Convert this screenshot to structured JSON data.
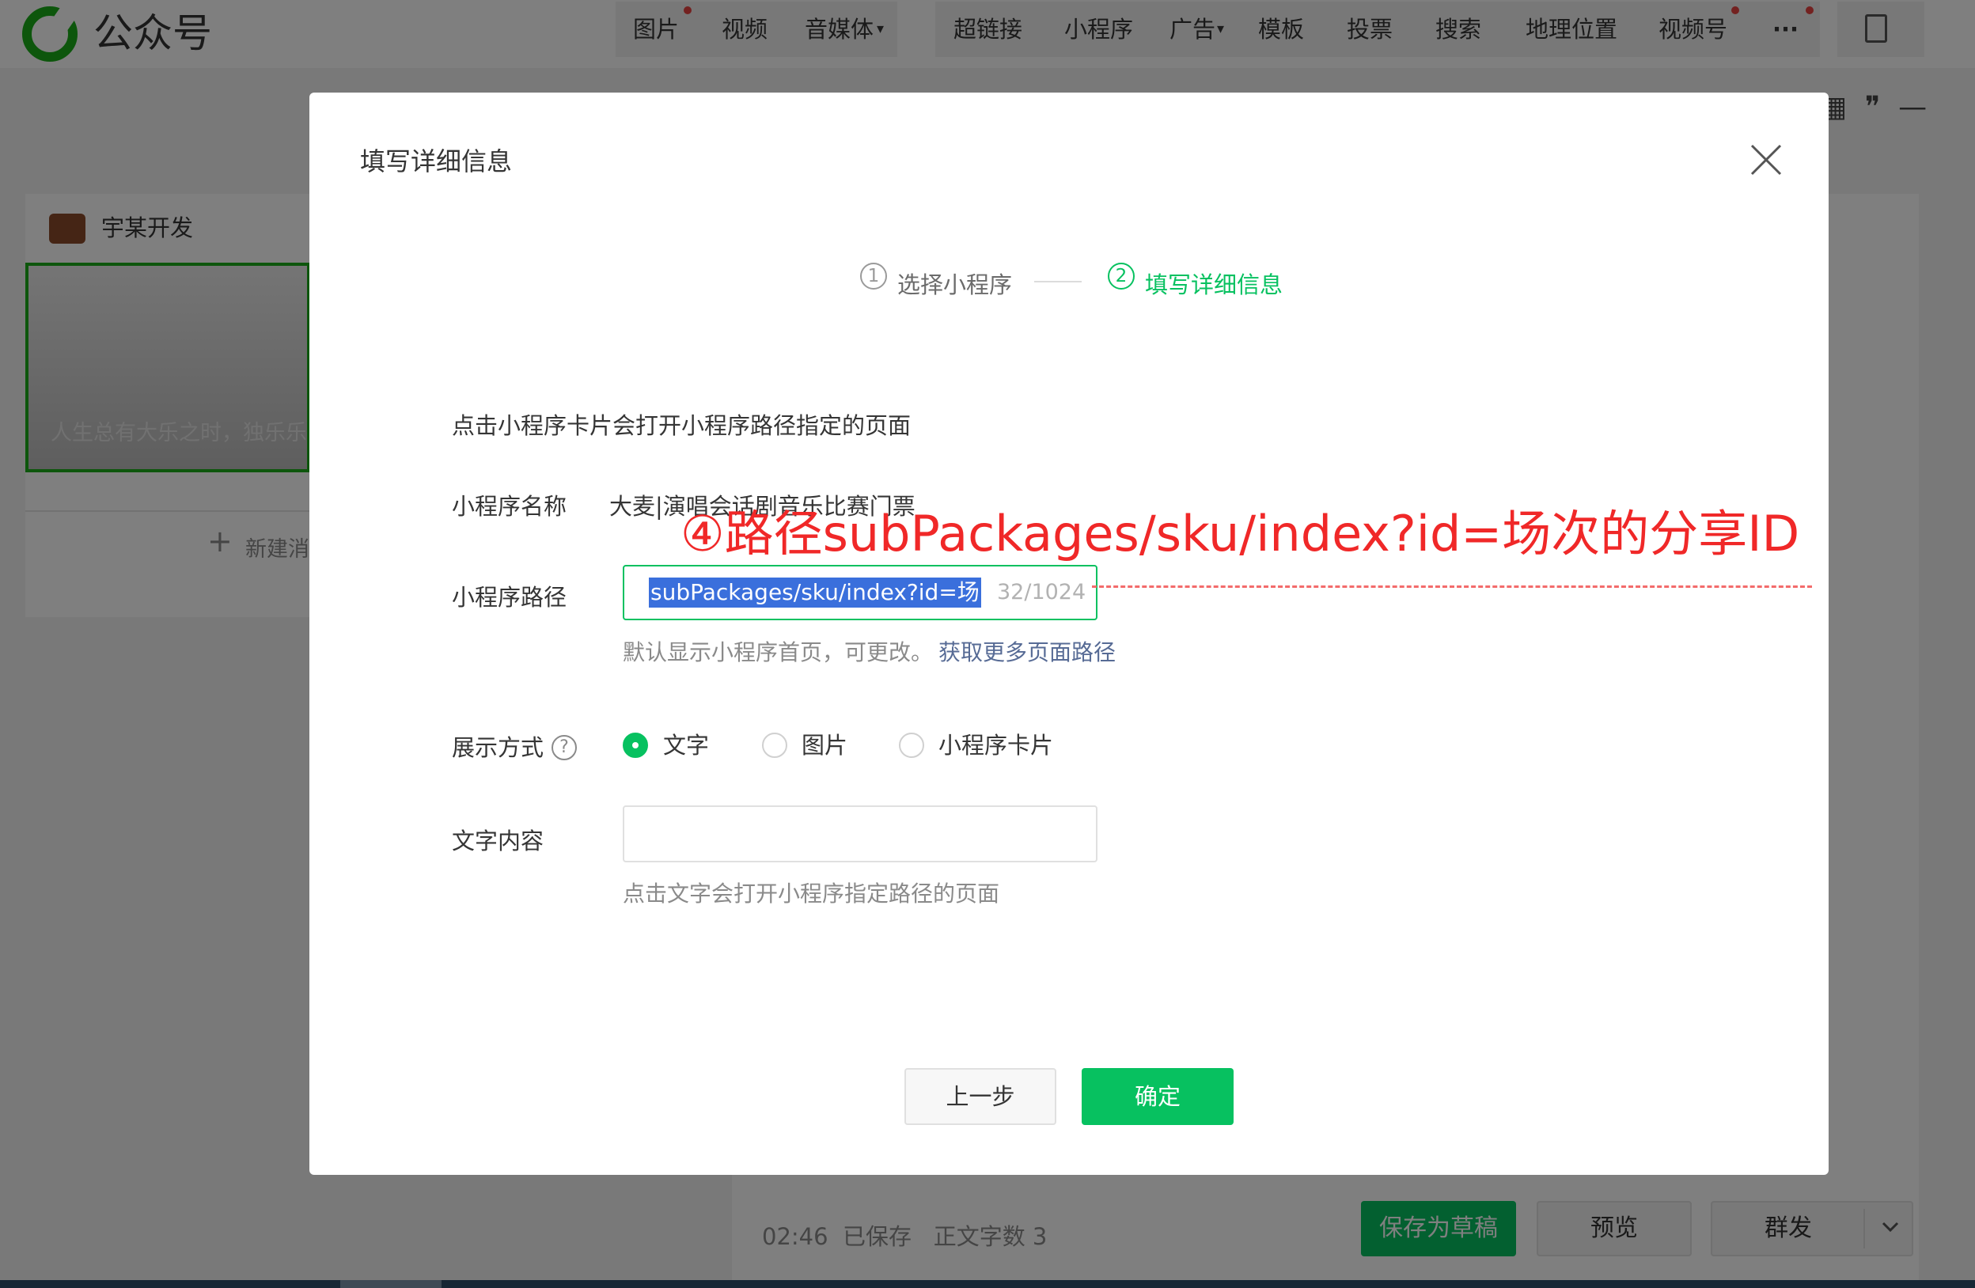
{
  "topbar": {
    "logo_text": "公众号",
    "tools": {
      "image": "图片",
      "video": "视频",
      "audio": "音媒体",
      "hyperlink": "超链接",
      "miniprogram": "小程序",
      "ad": "广告",
      "template": "模板",
      "vote": "投票",
      "search": "搜索",
      "location": "地理位置",
      "channels": "视频号",
      "more": "···"
    }
  },
  "editor": {
    "author": "宇某开发",
    "draft_title": "人生总有大乐之时，独乐乐",
    "new_message": "新建消",
    "status_time": "02:46",
    "status_saved": "已保存",
    "status_count": "正文字数 3",
    "save_draft": "保存为草稿",
    "preview": "预览",
    "publish": "群发"
  },
  "dialog": {
    "title": "填写详细信息",
    "steps": [
      {
        "num": "1",
        "label": "选择小程序",
        "state": "done"
      },
      {
        "num": "2",
        "label": "填写详细信息",
        "state": "active"
      }
    ],
    "intro": "点击小程序卡片会打开小程序路径指定的页面",
    "name_label": "小程序名称",
    "name_value": "大麦|演唱会话剧音乐比赛门票",
    "path_label": "小程序路径",
    "path_value": "subPackages/sku/index?id=场",
    "path_count": "32/1024",
    "path_hint": "默认显示小程序首页，可更改。",
    "path_more": "获取更多页面路径",
    "display_label": "展示方式",
    "display_options": [
      "文字",
      "图片",
      "小程序卡片"
    ],
    "display_selected": "文字",
    "content_label": "文字内容",
    "content_value": "",
    "content_hint": "点击文字会打开小程序指定路径的页面",
    "prev_button": "上一步",
    "ok_button": "确定"
  },
  "annotation": {
    "text": "④路径subPackages/sku/index?id=场次的分享ID",
    "color": "#f02828"
  },
  "colors": {
    "accent": "#07c160",
    "link": "#576b95",
    "selection": "#3a6fdc"
  }
}
